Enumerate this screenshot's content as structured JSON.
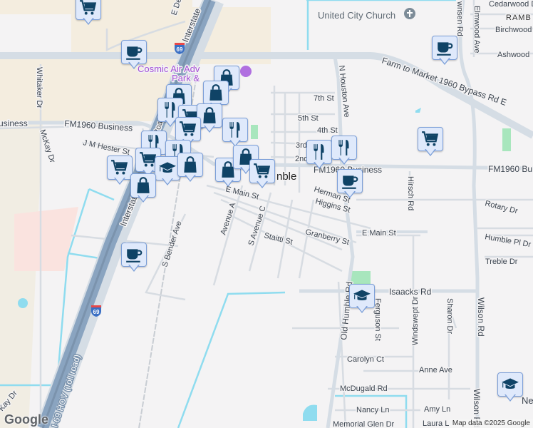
{
  "map": {
    "place_labels": {
      "church": "United City Church",
      "park": "Cosmic Air Adv",
      "park_line2": "Park &",
      "town": "Humble",
      "town_partial": "nble",
      "neighborhood": "RAMB"
    },
    "roads": {
      "fm1960_bypass": "Farm to Market 1960 Bypass Rd E",
      "fm1960_business_w": "FM1960 Business",
      "fm1960_business_w2": "usiness",
      "fm1960_business_e": "FM1960 Bu",
      "fm1960_business_mid": "FM1960 Business",
      "interstate_n": "Interstate",
      "interstate_s": "Interstate",
      "hov": "I-69 HOV (Toll road)",
      "e_main": "E Main St",
      "e_main_east": "E Main St",
      "jm_hester": "J M Hester St",
      "whitaker": "Whitaker Dr",
      "mckay": "McKay Dr",
      "kay": "Kay Dr",
      "n_houston": "N Houston Ave",
      "seventh": "7th St",
      "fifth": "5th St",
      "fourth": "4th St",
      "third": "3rd",
      "second": "2nd",
      "herman": "Herman St",
      "higgins": "Higgins St",
      "granberry": "Granberry St",
      "staitti": "Staitti St",
      "avenue_a": "Avenue A",
      "s_avenue_c": "S Avenue C",
      "s_bender": "S Bender Ave",
      "e_dev": "E Dev",
      "old_humble": "Old Humble Rd",
      "isaacks": "Isaacks Rd",
      "ferguson": "Ferguson St",
      "windswept": "Windswept Dr",
      "sharon": "Sharon Dr",
      "wilson": "Wilson Rd",
      "wilson2": "Wilson Rd",
      "hirsch": "Hirsch Rd",
      "townsen": "wnsen Rd",
      "elmwood": "Elmwood Ave",
      "cedarwood": "Cedarwood D",
      "birchwood": "Birchwood",
      "ashwood": "Ashwood",
      "rotary": "Rotary Dr",
      "humble_pl": "Humble Pl Dr",
      "treble": "Treble Dr",
      "carolyn": "Carolyn Ct",
      "anne": "Anne Ave",
      "mcdugald": "McDugald Rd",
      "nancy": "Nancy Ln",
      "amy": "Amy Ln",
      "memorial_glen": "Memorial Glen Dr",
      "laura": "Laura L",
      "road_partial": "Road",
      "ne_partial": "Ne"
    },
    "shields": [
      "69",
      "69"
    ],
    "markers": [
      {
        "type": "cart"
      },
      {
        "type": "coffee"
      },
      {
        "type": "coffee"
      },
      {
        "type": "bag"
      },
      {
        "type": "bag"
      },
      {
        "type": "bag"
      },
      {
        "type": "fork"
      },
      {
        "type": "cart"
      },
      {
        "type": "bag"
      },
      {
        "type": "cart"
      },
      {
        "type": "fork"
      },
      {
        "type": "fork"
      },
      {
        "type": "fork"
      },
      {
        "type": "cart"
      },
      {
        "type": "cart"
      },
      {
        "type": "cap"
      },
      {
        "type": "bag"
      },
      {
        "type": "bag"
      },
      {
        "type": "bag"
      },
      {
        "type": "cart"
      },
      {
        "type": "bag"
      },
      {
        "type": "fork"
      },
      {
        "type": "fork"
      },
      {
        "type": "coffee"
      },
      {
        "type": "cart"
      },
      {
        "type": "coffee"
      },
      {
        "type": "cap"
      },
      {
        "type": "cap"
      }
    ],
    "colors": {
      "marker_fill": "#dfe9fb",
      "marker_border": "#7c9fd8",
      "icon": "#0f4366",
      "water": "#8fdcef",
      "park": "#a8e6bd",
      "highway": "#8aa4c0"
    }
  },
  "footer": {
    "google_logo": "Google",
    "attribution": "Map data ©2025 Google"
  }
}
